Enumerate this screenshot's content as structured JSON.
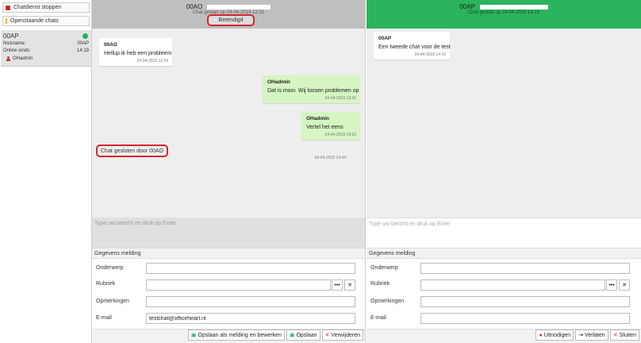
{
  "sidebar": {
    "stop_label": "Chatdienst stoppen",
    "open_label": "Openstaande chats",
    "chat": {
      "title": "00AP",
      "nickname_label": "Nickname:",
      "nickname_value": "00AP",
      "online_label": "Online sinds:",
      "online_value": "14:19",
      "agent": "OHadmin",
      "status_color": "#27ae60"
    }
  },
  "panel1": {
    "title": "00AO",
    "subtitle": "Chat gestart op 24-04-2019 12:31",
    "status": "Beeindigd",
    "messages": [
      {
        "who": "00AO",
        "text": "Hellup ik heb een probleem",
        "ts": "24-04-2019 12:34"
      },
      {
        "who": "OHadmin",
        "text": "Dat is mooi. Wij lossen problemen op",
        "ts": "24-04-2019 12:41"
      },
      {
        "who": "OHadmin",
        "text": "Vertel het eens",
        "ts": "24-04-2019 14:10"
      }
    ],
    "closed_text": "Chat gesloten door 00AO",
    "closed_ts": "24-04-2019 14:44",
    "input_placeholder": "Type uw bericht en druk op Enter",
    "form": {
      "title": "Gegevens melding",
      "labels": {
        "subject": "Onderwerp",
        "category": "Rubriek",
        "remarks": "Opmerkingen",
        "email": "E-mail"
      },
      "values": {
        "subject": "",
        "category": "",
        "remarks": "",
        "email": "testchat@officeheart.nl"
      }
    },
    "buttons": {
      "save_edit": "Opslaan als melding en bewerken",
      "save": "Opslaan",
      "delete": "Verwijderen"
    }
  },
  "panel2": {
    "title": "00AP",
    "subtitle": "Chat gestart op 24-04-2019 14:19",
    "messages": [
      {
        "who": "00AP",
        "text": "Een tweede chat voor de test",
        "ts": "24-04-2019 14:19"
      }
    ],
    "input_placeholder": "Type uw bericht en druk op Enter",
    "form": {
      "title": "Gegevens melding",
      "labels": {
        "subject": "Onderwerp",
        "category": "Rubriek",
        "remarks": "Opmerkingen",
        "email": "E-mail"
      },
      "values": {
        "subject": "",
        "category": "",
        "remarks": "",
        "email": ""
      }
    },
    "buttons": {
      "invite": "Uitnodigen",
      "leave": "Verlaten",
      "close": "Sluiten"
    }
  },
  "icons": {
    "more": "•••",
    "clear": "✕"
  }
}
